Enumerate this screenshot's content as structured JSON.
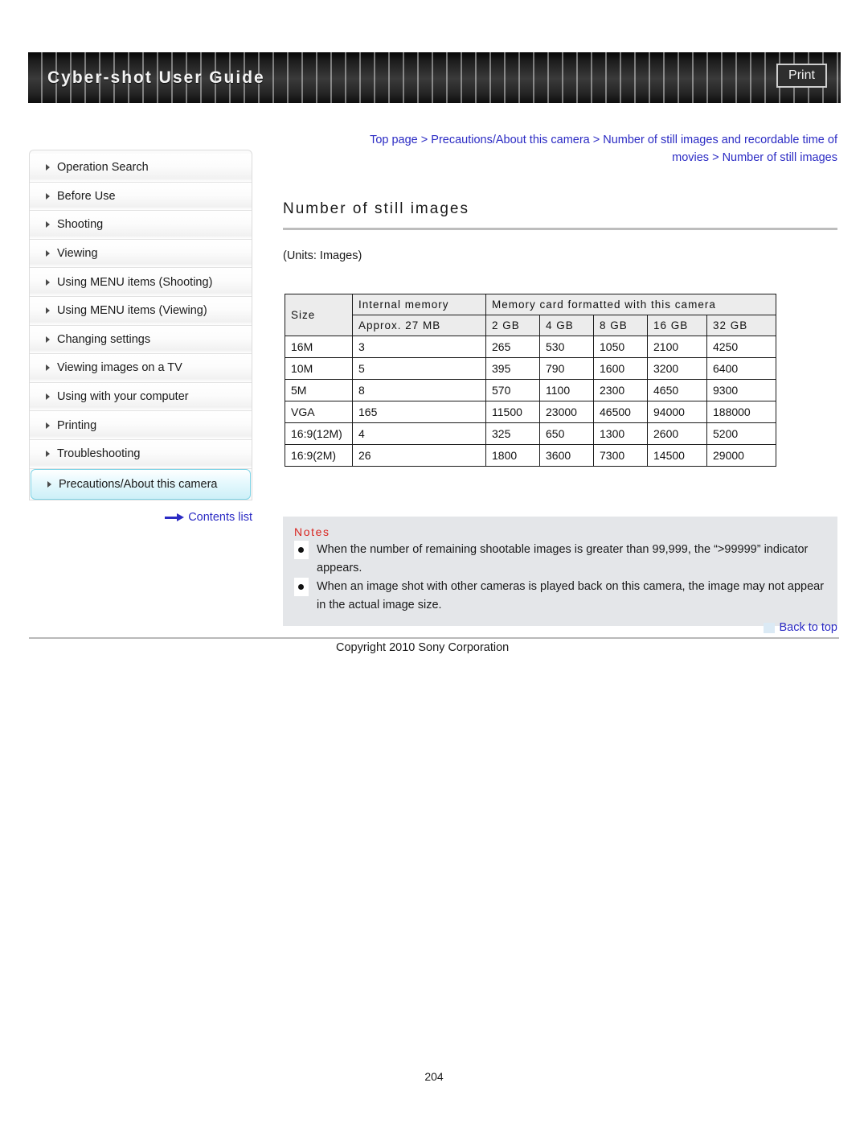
{
  "header": {
    "title": "Cyber-shot User Guide",
    "print_label": "Print"
  },
  "breadcrumb": {
    "line1": "Top page > Precautions/About this camera > Number of still images and recordable time of",
    "line2": "movies > Number of still images"
  },
  "sidebar": {
    "items": [
      {
        "label": "Operation Search",
        "active": false
      },
      {
        "label": "Before Use",
        "active": false
      },
      {
        "label": "Shooting",
        "active": false
      },
      {
        "label": "Viewing",
        "active": false
      },
      {
        "label": "Using MENU items (Shooting)",
        "active": false
      },
      {
        "label": "Using MENU items (Viewing)",
        "active": false
      },
      {
        "label": "Changing settings",
        "active": false
      },
      {
        "label": "Viewing images on a TV",
        "active": false
      },
      {
        "label": "Using with your computer",
        "active": false
      },
      {
        "label": "Printing",
        "active": false
      },
      {
        "label": "Troubleshooting",
        "active": false
      },
      {
        "label": "Precautions/About this camera",
        "active": true
      }
    ],
    "contents_list_label": "Contents list"
  },
  "main": {
    "page_title": "Number of still images",
    "units_label": "(Units: Images)",
    "table": {
      "header_size": "Size",
      "header_internal_memory": "Internal memory",
      "header_memory_card": "Memory card formatted with this camera",
      "header_internal_capacity": "Approx. 27 MB",
      "card_capacities": [
        "2 GB",
        "4 GB",
        "8 GB",
        "16 GB",
        "32 GB"
      ],
      "rows": [
        {
          "size": "16M",
          "internal": "3",
          "cards": [
            "265",
            "530",
            "1050",
            "2100",
            "4250"
          ]
        },
        {
          "size": "10M",
          "internal": "5",
          "cards": [
            "395",
            "790",
            "1600",
            "3200",
            "6400"
          ]
        },
        {
          "size": "5M",
          "internal": "8",
          "cards": [
            "570",
            "1100",
            "2300",
            "4650",
            "9300"
          ]
        },
        {
          "size": "VGA",
          "internal": "165",
          "cards": [
            "11500",
            "23000",
            "46500",
            "94000",
            "188000"
          ]
        },
        {
          "size": "16:9(12M)",
          "internal": "4",
          "cards": [
            "325",
            "650",
            "1300",
            "2600",
            "5200"
          ]
        },
        {
          "size": "16:9(2M)",
          "internal": "26",
          "cards": [
            "1800",
            "3600",
            "7300",
            "14500",
            "29000"
          ]
        }
      ]
    },
    "notes": {
      "title": "Notes",
      "items": [
        "When the number of remaining shootable images is greater than 99,999, the “>99999” indicator appears.",
        "When an image shot with other cameras is played back on this camera, the image may not appear in the actual image size."
      ]
    }
  },
  "footer": {
    "back_to_top_label": "Back to top",
    "copyright": "Copyright 2010 Sony Corporation",
    "page_number": "204"
  },
  "colors": {
    "link": "#2b2bc4",
    "notes_title": "#d8241f",
    "active_item_bg": "#cdf0f8",
    "table_header_bg": "#ececec",
    "notes_bg": "#e4e6e9"
  }
}
